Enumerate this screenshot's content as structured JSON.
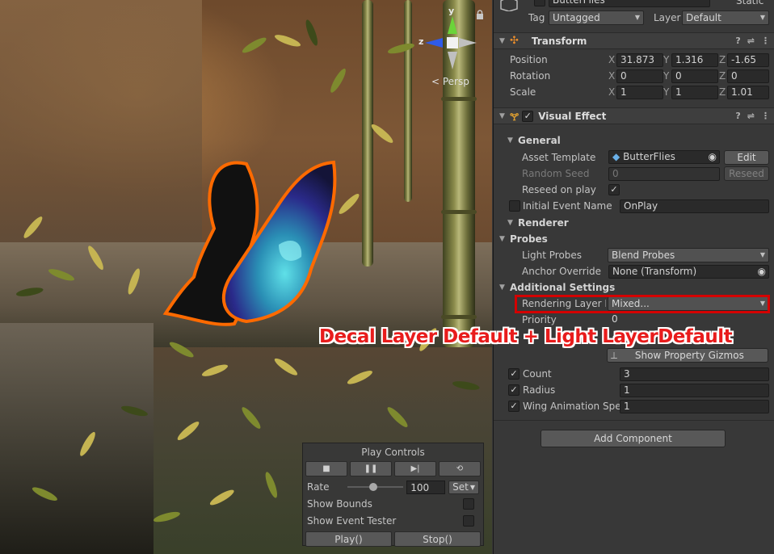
{
  "header": {
    "object_name": "ButterFlies",
    "static_label": "Static",
    "tag_label": "Tag",
    "tag_value": "Untagged",
    "layer_label": "Layer",
    "layer_value": "Default"
  },
  "transform": {
    "title": "Transform",
    "position": {
      "label": "Position",
      "x": "31.873",
      "y": "1.316",
      "z": "-1.65"
    },
    "rotation": {
      "label": "Rotation",
      "x": "0",
      "y": "0",
      "z": "0"
    },
    "scale": {
      "label": "Scale",
      "x": "1",
      "y": "1",
      "z": "1.01"
    },
    "axis_x": "X",
    "axis_y": "Y",
    "axis_z": "Z"
  },
  "visual_effect": {
    "title": "Visual Effect",
    "general": "General",
    "asset_template_label": "Asset Template",
    "asset_template_value": "ButterFlies",
    "edit_button": "Edit",
    "random_seed_label": "Random Seed",
    "random_seed_value": "0",
    "reseed_button": "Reseed",
    "reseed_on_play_label": "Reseed on play",
    "initial_event_label": "Initial Event Name",
    "initial_event_value": "OnPlay",
    "renderer": "Renderer",
    "probes": "Probes",
    "light_probes_label": "Light Probes",
    "light_probes_value": "Blend Probes",
    "anchor_override_label": "Anchor Override",
    "anchor_override_value": "None (Transform)",
    "additional_settings": "Additional Settings",
    "rendering_layer_label": "Rendering Layer M",
    "rendering_layer_value": "Mixed...",
    "priority_label": "Priority",
    "priority_value": "0",
    "show_gizmos_button": "Show Property Gizmos",
    "count_label": "Count",
    "count_value": "3",
    "radius_label": "Radius",
    "radius_value": "1",
    "wing_label": "Wing Animation Spee",
    "wing_value": "1"
  },
  "add_component": "Add Component",
  "overlay_note": "Decal Layer Default + Light LayerDefault",
  "scene": {
    "persp_label": "< Persp",
    "gizmo_y": "y",
    "gizmo_z": "z"
  },
  "play_controls": {
    "title": "Play Controls",
    "stop_icon": "■",
    "pause_icon": "❚❚",
    "step_icon": "▶|",
    "restart_icon": "⟲",
    "rate_label": "Rate",
    "rate_value": "100",
    "rate_fraction": 0.45,
    "set_label": "Set",
    "show_bounds": "Show Bounds",
    "show_event_tester": "Show Event Tester",
    "play_button": "Play()",
    "stop_button": "Stop()"
  },
  "colors": {
    "highlight": "#d40000",
    "overlay_text": "#e81c1c",
    "butterfly_outline": "#ff6a00"
  }
}
